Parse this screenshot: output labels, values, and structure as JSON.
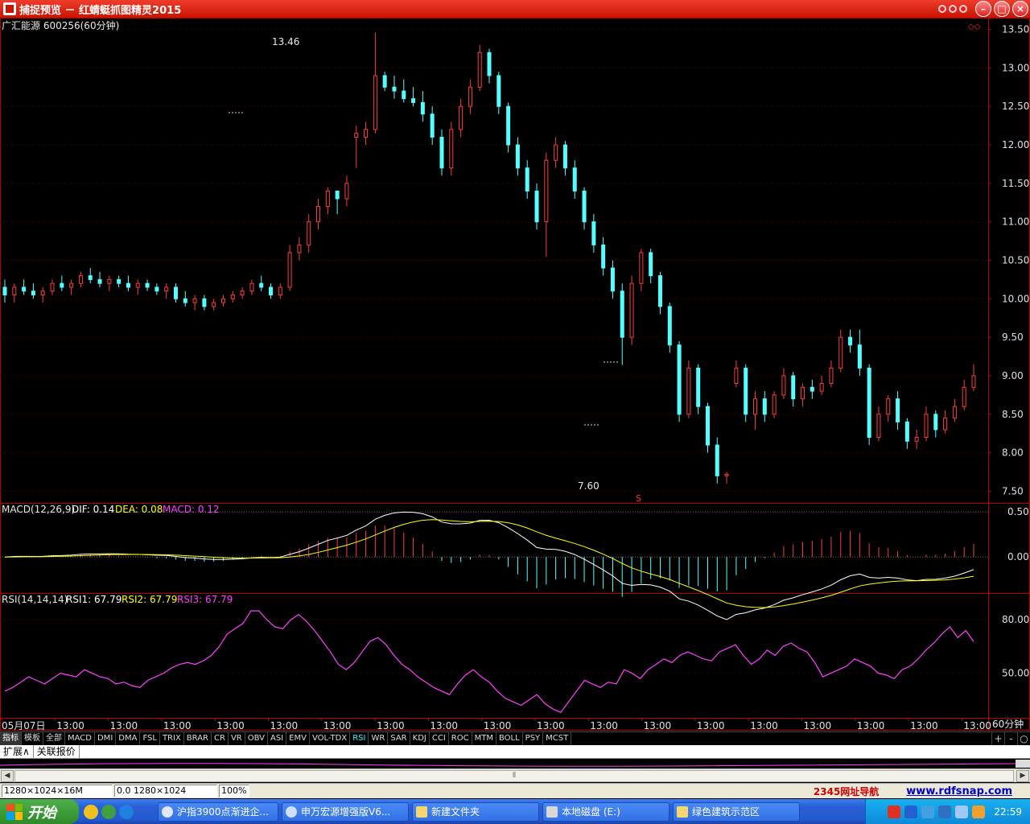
{
  "window": {
    "title": "捕捉预览 － 红蜻蜓抓图精灵2015"
  },
  "chart": {
    "title": "广汇能源 600256(60分钟)",
    "main_yaxis": [
      "13.50",
      "13.00",
      "12.50",
      "12.00",
      "11.50",
      "11.00",
      "10.50",
      "10.00",
      "9.50",
      "9.00",
      "8.50",
      "8.00",
      "7.50"
    ],
    "high_label": "13.46",
    "low_label": "7.60",
    "s_marker": "S",
    "macd": {
      "label": "MACD(12,26,9)",
      "dif": "DIF: 0.14",
      "dea": "DEA: 0.08",
      "macd": "MACD: 0.12",
      "yaxis": [
        "0.50",
        "0.00"
      ]
    },
    "rsi": {
      "label": "RSI(14,14,14)",
      "rsi1": "RSI1: 67.79",
      "rsi2": "RSI2: 67.79",
      "rsi3": "RSI3: 67.79",
      "yaxis": [
        "80.00",
        "50.00"
      ]
    },
    "xaxis": [
      "05月07日",
      "13:00",
      "13:00",
      "13:00",
      "13:00",
      "13:00",
      "13:00",
      "13:00",
      "13:00",
      "13:00",
      "13:00",
      "13:00",
      "13:00",
      "13:00",
      "13:00",
      "13:00",
      "13:00",
      "13:00",
      "13:00"
    ],
    "period": "60分钟",
    "colors": {
      "up": "#ff3c3c",
      "down": "#54ffff",
      "dif": "#ffffff",
      "dea": "#ffff00",
      "rsi": "#ff40ff",
      "frame": "#b40000"
    }
  },
  "chart_data": {
    "type": "candlestick",
    "title": "广汇能源 600256(60分钟)",
    "ylim": [
      7.4,
      13.6
    ],
    "ohlc": [
      [
        10.15,
        10.25,
        9.95,
        10.05
      ],
      [
        10.05,
        10.2,
        9.95,
        10.15
      ],
      [
        10.15,
        10.25,
        10.05,
        10.1
      ],
      [
        10.1,
        10.2,
        10.0,
        10.05
      ],
      [
        10.05,
        10.15,
        9.95,
        10.1
      ],
      [
        10.1,
        10.25,
        10.05,
        10.2
      ],
      [
        10.2,
        10.3,
        10.1,
        10.15
      ],
      [
        10.15,
        10.25,
        10.05,
        10.2
      ],
      [
        10.2,
        10.35,
        10.15,
        10.3
      ],
      [
        10.3,
        10.4,
        10.2,
        10.25
      ],
      [
        10.25,
        10.35,
        10.15,
        10.2
      ],
      [
        10.2,
        10.3,
        10.1,
        10.25
      ],
      [
        10.25,
        10.3,
        10.15,
        10.2
      ],
      [
        10.2,
        10.3,
        10.1,
        10.15
      ],
      [
        10.15,
        10.25,
        10.05,
        10.2
      ],
      [
        10.2,
        10.25,
        10.1,
        10.15
      ],
      [
        10.15,
        10.2,
        10.05,
        10.1
      ],
      [
        10.1,
        10.2,
        10.0,
        10.15
      ],
      [
        10.15,
        10.2,
        9.95,
        10.0
      ],
      [
        10.0,
        10.1,
        9.9,
        9.95
      ],
      [
        9.95,
        10.05,
        9.85,
        10.0
      ],
      [
        10.0,
        10.05,
        9.85,
        9.9
      ],
      [
        9.9,
        10.0,
        9.85,
        9.95
      ],
      [
        9.95,
        10.05,
        9.9,
        10.0
      ],
      [
        10.0,
        10.1,
        9.95,
        10.05
      ],
      [
        10.05,
        10.15,
        10.0,
        10.1
      ],
      [
        10.1,
        10.25,
        10.05,
        10.2
      ],
      [
        10.2,
        10.3,
        10.1,
        10.15
      ],
      [
        10.15,
        10.2,
        10.0,
        10.05
      ],
      [
        10.05,
        10.2,
        10.0,
        10.15
      ],
      [
        10.15,
        10.7,
        10.1,
        10.6
      ],
      [
        10.6,
        10.8,
        10.5,
        10.7
      ],
      [
        10.7,
        11.1,
        10.6,
        11.0
      ],
      [
        11.0,
        11.3,
        10.9,
        11.2
      ],
      [
        11.2,
        11.45,
        11.1,
        11.4
      ],
      [
        11.4,
        11.4,
        11.1,
        11.3
      ],
      [
        11.3,
        11.6,
        11.2,
        11.5
      ],
      [
        12.1,
        12.25,
        11.7,
        12.15
      ],
      [
        12.1,
        12.3,
        12.0,
        12.2
      ],
      [
        12.2,
        13.46,
        12.15,
        12.9
      ],
      [
        12.9,
        12.95,
        12.7,
        12.75
      ],
      [
        12.75,
        12.9,
        12.6,
        12.7
      ],
      [
        12.7,
        12.85,
        12.55,
        12.6
      ],
      [
        12.6,
        12.75,
        12.5,
        12.55
      ],
      [
        12.55,
        12.7,
        12.3,
        12.4
      ],
      [
        12.4,
        12.5,
        12.0,
        12.1
      ],
      [
        12.1,
        12.2,
        11.6,
        11.7
      ],
      [
        11.7,
        12.3,
        11.6,
        12.2
      ],
      [
        12.2,
        12.6,
        12.1,
        12.5
      ],
      [
        12.5,
        12.85,
        12.4,
        12.75
      ],
      [
        12.75,
        13.3,
        12.7,
        13.2
      ],
      [
        13.2,
        13.25,
        12.8,
        12.9
      ],
      [
        12.9,
        12.95,
        12.4,
        12.5
      ],
      [
        12.5,
        12.55,
        11.9,
        12.0
      ],
      [
        12.0,
        12.1,
        11.6,
        11.7
      ],
      [
        11.7,
        11.8,
        11.3,
        11.4
      ],
      [
        11.4,
        11.5,
        10.9,
        11.0
      ],
      [
        11.0,
        11.9,
        10.55,
        11.8
      ],
      [
        11.8,
        12.1,
        11.7,
        12.0
      ],
      [
        12.0,
        12.05,
        11.6,
        11.7
      ],
      [
        11.7,
        11.8,
        11.3,
        11.4
      ],
      [
        11.4,
        11.45,
        10.9,
        11.0
      ],
      [
        11.0,
        11.1,
        10.6,
        10.7
      ],
      [
        10.7,
        10.8,
        10.3,
        10.4
      ],
      [
        10.4,
        10.5,
        10.0,
        10.1
      ],
      [
        10.1,
        10.2,
        9.14,
        9.5
      ],
      [
        9.5,
        10.3,
        9.4,
        10.2
      ],
      [
        10.2,
        10.65,
        10.1,
        10.6
      ],
      [
        10.6,
        10.65,
        10.2,
        10.3
      ],
      [
        10.3,
        10.35,
        9.8,
        9.9
      ],
      [
        9.9,
        9.95,
        9.3,
        9.4
      ],
      [
        9.4,
        9.45,
        8.4,
        8.5
      ],
      [
        8.5,
        9.2,
        8.45,
        9.1
      ],
      [
        9.1,
        9.15,
        8.5,
        8.6
      ],
      [
        8.6,
        8.65,
        8.0,
        8.1
      ],
      [
        8.1,
        8.2,
        7.6,
        7.7
      ],
      [
        7.7,
        7.75,
        7.6,
        7.72
      ],
      [
        8.9,
        9.2,
        8.85,
        9.1
      ],
      [
        9.1,
        9.15,
        8.4,
        8.5
      ],
      [
        8.5,
        8.8,
        8.3,
        8.7
      ],
      [
        8.7,
        8.8,
        8.4,
        8.5
      ],
      [
        8.5,
        8.8,
        8.45,
        8.75
      ],
      [
        8.75,
        9.1,
        8.7,
        9.0
      ],
      [
        9.0,
        9.05,
        8.6,
        8.7
      ],
      [
        8.7,
        8.9,
        8.6,
        8.85
      ],
      [
        8.85,
        8.95,
        8.7,
        8.8
      ],
      [
        8.8,
        9.0,
        8.75,
        8.9
      ],
      [
        8.9,
        9.2,
        8.85,
        9.1
      ],
      [
        9.1,
        9.6,
        9.05,
        9.5
      ],
      [
        9.5,
        9.6,
        9.3,
        9.4
      ],
      [
        9.4,
        9.6,
        9.0,
        9.1
      ],
      [
        9.1,
        9.15,
        8.1,
        8.2
      ],
      [
        8.2,
        8.6,
        8.15,
        8.5
      ],
      [
        8.5,
        8.75,
        8.4,
        8.7
      ],
      [
        8.7,
        8.8,
        8.3,
        8.4
      ],
      [
        8.4,
        8.45,
        8.05,
        8.15
      ],
      [
        8.15,
        8.3,
        8.05,
        8.2
      ],
      [
        8.2,
        8.6,
        8.15,
        8.5
      ],
      [
        8.5,
        8.55,
        8.2,
        8.3
      ],
      [
        8.3,
        8.55,
        8.25,
        8.45
      ],
      [
        8.45,
        8.7,
        8.4,
        8.6
      ],
      [
        8.6,
        8.95,
        8.55,
        8.85
      ],
      [
        8.85,
        9.15,
        8.8,
        9.0
      ]
    ],
    "macd": {
      "dif_last": 0.14,
      "dea_last": 0.08,
      "macd_last": 0.12,
      "ylim": [
        -0.4,
        0.6
      ]
    },
    "rsi": {
      "last": 67.79,
      "ylim": [
        25,
        95
      ],
      "values": [
        40,
        42,
        45,
        48,
        46,
        44,
        47,
        50,
        49,
        48,
        52,
        50,
        48,
        47,
        44,
        45,
        43,
        42,
        46,
        48,
        50,
        53,
        55,
        56,
        55,
        57,
        60,
        65,
        72,
        75,
        78,
        85,
        85,
        80,
        76,
        75,
        80,
        83,
        79,
        74,
        68,
        62,
        55,
        52,
        56,
        62,
        68,
        70,
        66,
        60,
        55,
        52,
        48,
        45,
        42,
        40,
        38,
        44,
        49,
        52,
        48,
        45,
        40,
        36,
        34,
        32,
        35,
        38,
        33,
        30,
        28,
        34,
        40,
        46,
        44,
        42,
        45,
        44,
        52,
        50,
        47,
        52,
        55,
        58,
        56,
        60,
        62,
        60,
        58,
        57,
        62,
        64,
        66,
        60,
        55,
        58,
        63,
        60,
        65,
        67,
        64,
        62,
        56,
        48,
        50,
        52,
        54,
        58,
        56,
        54,
        50,
        49,
        47,
        52,
        54,
        58,
        63,
        67,
        72,
        76,
        70,
        74,
        67.79
      ]
    }
  },
  "tabs": [
    "指标",
    "模板",
    "全部",
    "MACD",
    "DMI",
    "DMA",
    "FSL",
    "TRIX",
    "BRAR",
    "CR",
    "VR",
    "OBV",
    "ASI",
    "EMV",
    "VOL-TDX",
    "RSI",
    "WR",
    "SAR",
    "KDJ",
    "CCI",
    "ROC",
    "MTM",
    "BOLL",
    "PSY",
    "MCST"
  ],
  "active_tab": "指标",
  "mini_buttons": [
    "+",
    "-",
    "○"
  ],
  "subtabs": [
    "扩展∧",
    "关联报价"
  ],
  "status": {
    "f1": "1280×1024×16M",
    "f2": "0.0 1280×1024",
    "f3": "100%",
    "nav": "2345网址导航",
    "url": "www.rdfsnap.com"
  },
  "taskbar": {
    "start": "开始",
    "tasks": [
      "沪指3900点渐进企...",
      "申万宏源增强版V6...",
      "新建文件夹",
      "本地磁盘 (E:)",
      "绿色建筑示范区"
    ],
    "clock": "22:59"
  }
}
